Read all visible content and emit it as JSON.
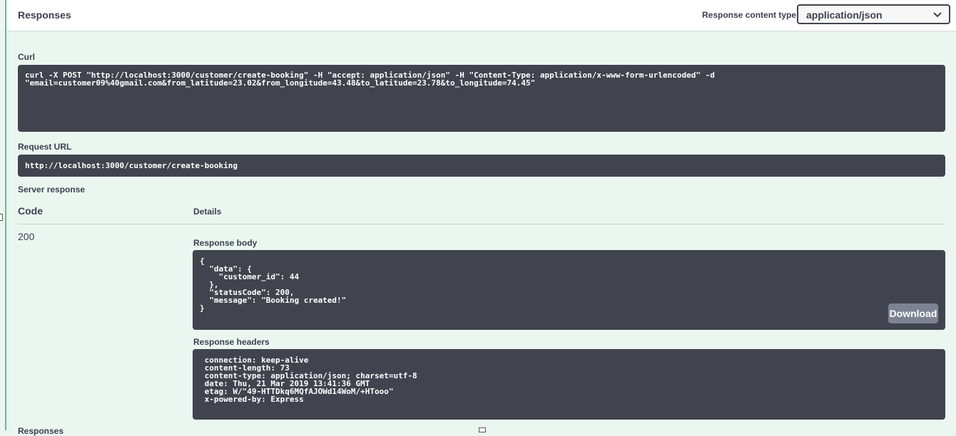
{
  "header": {
    "title": "Responses",
    "content_type_label": "Response content type",
    "content_type_value": "application/json",
    "chevron_icon": "chevron-down-icon"
  },
  "curl": {
    "label": "Curl",
    "command": "curl -X POST \"http://localhost:3000/customer/create-booking\" -H \"accept: application/json\" -H \"Content-Type: application/x-www-form-urlencoded\" -d\n\"email=customer09%40gmail.com&from_latitude=23.02&from_longitude=43.48&to_latitude=23.78&to_longitude=74.45\""
  },
  "request_url": {
    "label": "Request URL",
    "value": "http://localhost:3000/customer/create-booking"
  },
  "server_response": {
    "label": "Server response",
    "code_header": "Code",
    "details_header": "Details",
    "code": "200",
    "body_label": "Response body",
    "body": "{\n  \"data\": {\n    \"customer_id\": 44\n  },\n  \"statusCode\": 200,\n  \"message\": \"Booking created!\"\n}",
    "download_label": "Download",
    "headers_label": "Response headers",
    "headers": " connection: keep-alive\n content-length: 73\n content-type: application/json; charset=utf-8\n date: Thu, 21 Mar 2019 13:41:36 GMT\n etag: W/\"49-HTTDkq6MQfAJOWd14WoM/+HTooo\"\n x-powered-by: Express"
  },
  "footer": {
    "next_section_label": "Responses"
  },
  "colors": {
    "accent": "#49cc90",
    "section_bg": "#ebf6f0",
    "code_bg": "#41444e",
    "download_bg": "#7d8293"
  }
}
